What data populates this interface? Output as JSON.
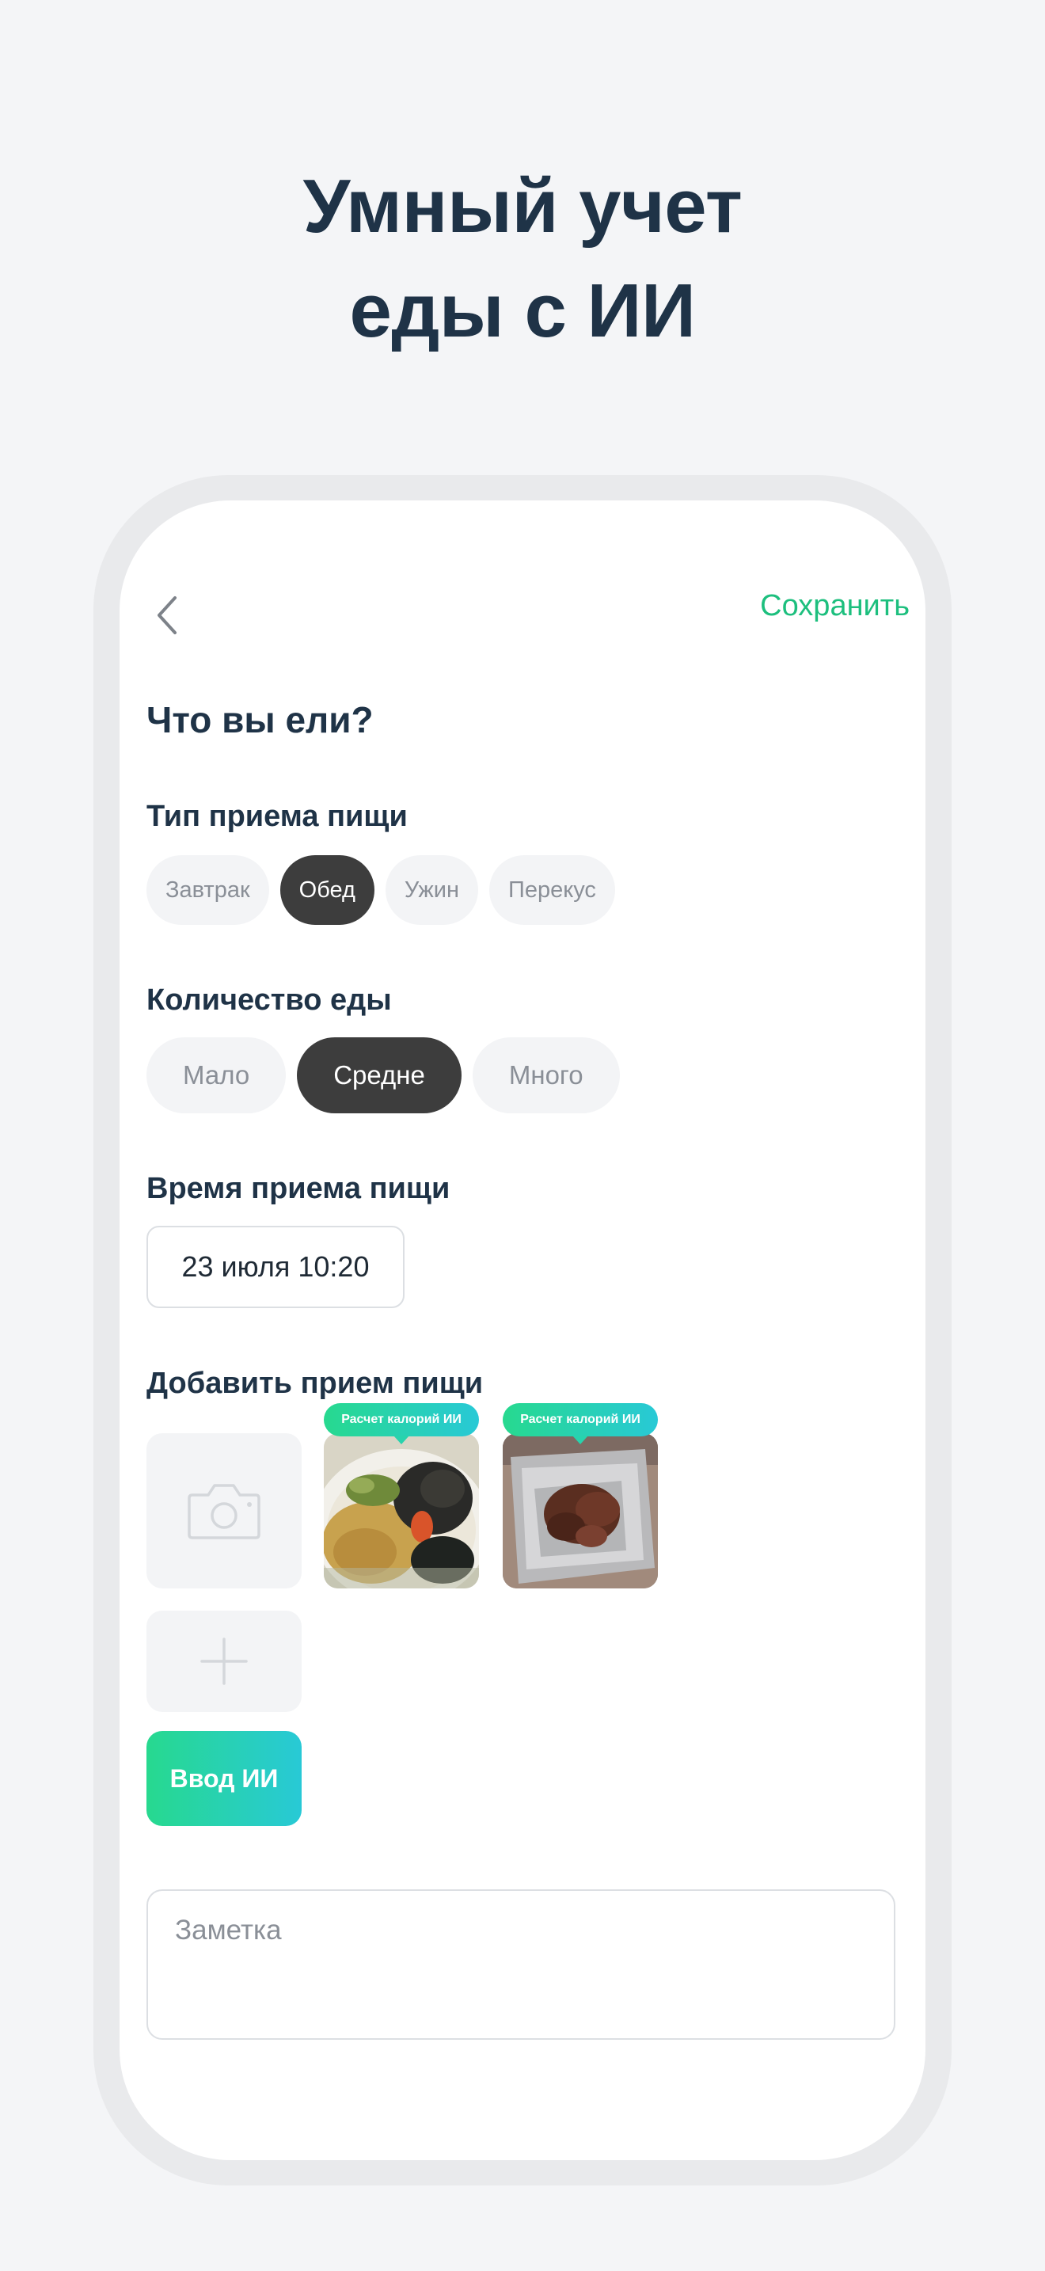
{
  "headline": {
    "line1": "Умный учет",
    "line2": "еды с ИИ"
  },
  "header": {
    "save_label": "Сохранить"
  },
  "screen_title": "Что вы ели?",
  "meal_type": {
    "label": "Тип приема пищи",
    "options": [
      "Завтрак",
      "Обед",
      "Ужин",
      "Перекус"
    ],
    "selected": "Обед"
  },
  "amount": {
    "label": "Количество еды",
    "options": [
      "Мало",
      "Средне",
      "Много"
    ],
    "selected": "Средне"
  },
  "meal_time": {
    "label": "Время приема пищи",
    "value": "23 июля 10:20"
  },
  "add_meal": {
    "label": "Добавить прием пищи",
    "photos": [
      {
        "badge": "Расчет калорий ИИ"
      },
      {
        "badge": "Расчет калорий ИИ"
      }
    ],
    "ai_input_label": "Ввод ИИ"
  },
  "note": {
    "placeholder": "Заметка"
  },
  "colors": {
    "accent": "#1dbf7e",
    "gradient_start": "#27d98f",
    "gradient_end": "#28c9d6",
    "selected_chip": "#3d3d3d"
  },
  "icons": [
    "chevron-left-icon",
    "camera-icon",
    "plus-icon"
  ]
}
